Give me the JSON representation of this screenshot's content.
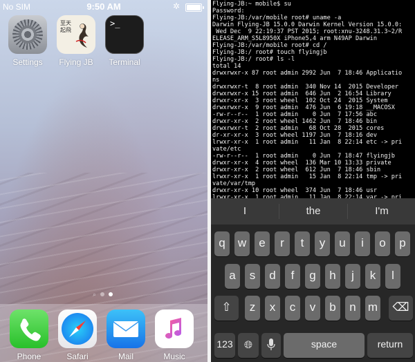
{
  "left_screen": {
    "status_bar": {
      "carrier": "No SIM",
      "time": "9:50 AM",
      "bluetooth_icon": "bluetooth-icon",
      "battery_level": 1.0
    },
    "apps": [
      {
        "label": "Settings",
        "icon": "settings-gear-icon"
      },
      {
        "label": "Flying JB",
        "icon": "flying-jb-icon",
        "icon_text": "至天起飛"
      },
      {
        "label": "Terminal",
        "icon": "terminal-icon",
        "icon_text": ">_"
      }
    ],
    "page_dots": {
      "count": 2,
      "active": 1
    },
    "dock": [
      {
        "label": "Phone",
        "icon": "phone-icon"
      },
      {
        "label": "Safari",
        "icon": "safari-compass-icon"
      },
      {
        "label": "Mail",
        "icon": "mail-envelope-icon"
      },
      {
        "label": "Music",
        "icon": "music-note-icon"
      }
    ]
  },
  "terminal": {
    "text": "Flying-JB:~ mobile$ su\nPassword:\nFlying-JB:/var/mobile root# uname -a\nDarwin Flying-JB 15.0.0 Darwin Kernel Version 15.0.0:\n Wed Dec  9 22:19:37 PST 2015; root:xnu-3248.31.3~2/R\nELEASE_ARM_S5L8950X iPhone5,4 arm N49AP Darwin\nFlying-JB:/var/mobile root# cd /\nFlying-JB:/ root# touch flyingjb\nFlying-JB:/ root# ls -l\ntotal 14\ndrwxrwxr-x 87 root admin 2992 Jun  7 18:46 Applicatio\nns\ndrwxrwxr-t  8 root admin  340 Nov 14  2015 Developer\ndrwxrwxr-x 15 root admin  646 Jun  2 16:54 Library\ndrwxr-xr-x  3 root wheel  102 Oct 24  2015 System\ndrwxrwxr-x  9 root admin  476 Jun  6 19:18 __MACOSX\n-rw-r--r--  1 root admin    0 Jun  7 17:56 abc\ndrwxr-xr-x  2 root wheel 1462 Jun  7 18:46 bin\ndrwxrwxr-t  2 root admin   68 Oct 28  2015 cores\ndr-xr-xr-x  3 root wheel 1197 Jun  7 18:16 dev\nlrwxr-xr-x  1 root admin   11 Jan  8 22:14 etc -> pri\nvate/etc\n-rw-r--r--  1 root admin    0 Jun  7 18:47 flyingjb\ndrwxr-xr-x  4 root wheel  136 Mar 10 13:33 private\ndrwxr-xr-x  2 root wheel  612 Jun  7 18:46 sbin\nlrwxr-xr-x  1 root admin   15 Jan  8 22:14 tmp -> pri\nvate/var/tmp\ndrwxr-xr-x 10 root wheel  374 Jun  7 18:46 usr\nlrwxr-xr-x  1 root admin   11 Jan  8 22:14 var -> pri\nvate/var\nFlying-JB:/ root# "
  },
  "keyboard": {
    "predictions": [
      "I",
      "the",
      "I'm"
    ],
    "row1": [
      "q",
      "w",
      "e",
      "r",
      "t",
      "y",
      "u",
      "i",
      "o",
      "p"
    ],
    "row2": [
      "a",
      "s",
      "d",
      "f",
      "g",
      "h",
      "j",
      "k",
      "l"
    ],
    "row3": [
      "z",
      "x",
      "c",
      "v",
      "b",
      "n",
      "m"
    ],
    "shift_icon": "shift-arrow-icon",
    "delete_icon": "backspace-icon",
    "numbers_label": "123",
    "globe_icon": "globe-icon",
    "mic_icon": "microphone-icon",
    "space_label": "space",
    "return_label": "return"
  }
}
